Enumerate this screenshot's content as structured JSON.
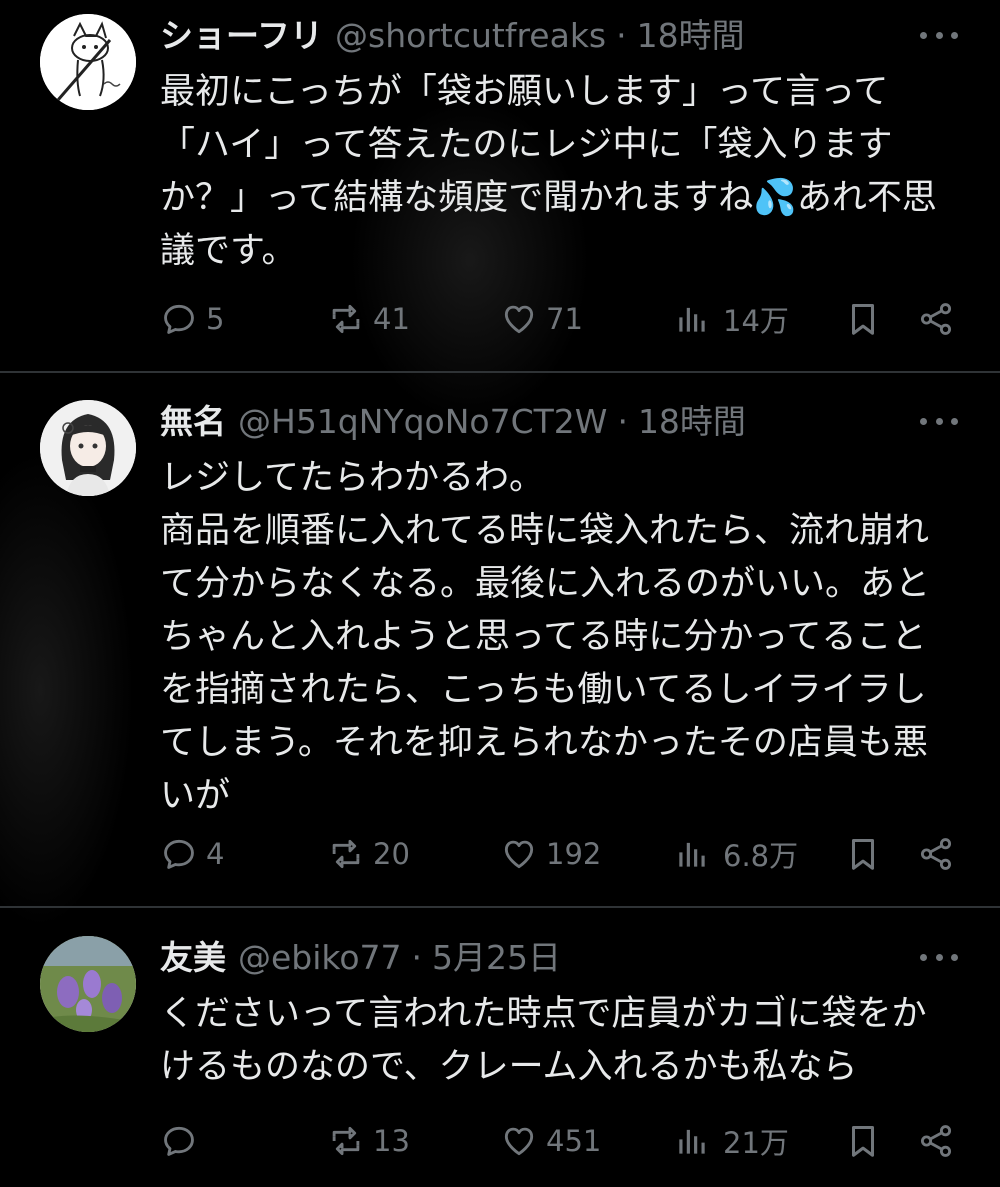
{
  "tweets": [
    {
      "name": "ショーフリ",
      "handle": "@shortcutfreaks",
      "time": "18時間",
      "text": "最初にこっちが「袋お願いします」って言って\n「ハイ」って答えたのにレジ中に「袋入ります\nか？」って結構な頻度で聞かれますね💦あれ不思\n議です。",
      "replies": "5",
      "retweets": "41",
      "likes": "71",
      "views": "14万",
      "avatar_icon": "cat-doodle-avatar"
    },
    {
      "name": "無名",
      "handle": "@H51qNYqoNo7CT2W",
      "time": "18時間",
      "text": "レジしてたらわかるわ。\n商品を順番に入れてる時に袋入れたら、流れ崩れ\nて分からなくなる。最後に入れるのがいい。あと\nちゃんと入れようと思ってる時に分かってること\nを指摘されたら、こっちも働いてるしイライラし\nてしまう。それを抑えられなかったその店員も悪\nいが",
      "replies": "4",
      "retweets": "20",
      "likes": "192",
      "views": "6.8万",
      "avatar_icon": "anime-girl-avatar"
    },
    {
      "name": "友美",
      "handle": "@ebiko77",
      "time": "5月25日",
      "text": "くださいって言われた時点で店員がカゴに袋をか\nけるものなので、クレーム入れるかも私なら",
      "replies": "",
      "retweets": "13",
      "likes": "451",
      "views": "21万",
      "avatar_icon": "purple-flowers-avatar"
    }
  ],
  "separator": "·",
  "colors": {
    "background": "#000000",
    "text": "#e7e9ea",
    "muted": "#71767b",
    "divider": "#2f3336"
  }
}
